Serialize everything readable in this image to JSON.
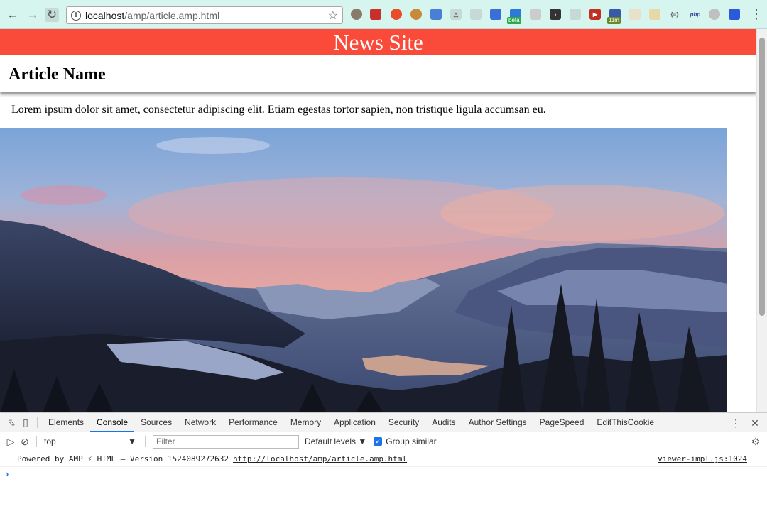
{
  "browser": {
    "url_host": "localhost",
    "url_path": "/amp/article.amp.html",
    "extension_badges": [
      "beta",
      "11m"
    ],
    "ext_labels": [
      "php"
    ]
  },
  "page": {
    "site_title": "News Site",
    "article_title": "Article Name",
    "body_text": "Lorem ipsum dolor sit amet, consectetur adipiscing elit. Etiam egestas tortor sapien, non tristique ligula accumsan eu."
  },
  "devtools": {
    "tabs": [
      "Elements",
      "Console",
      "Sources",
      "Network",
      "Performance",
      "Memory",
      "Application",
      "Security",
      "Audits",
      "Author Settings",
      "PageSpeed",
      "EditThisCookie"
    ],
    "active_tab": "Console",
    "context": "top",
    "filter_placeholder": "Filter",
    "levels": "Default levels",
    "group_similar": "Group similar",
    "console_message": "Powered by AMP ⚡ HTML – Version 1524089272632",
    "console_link": "http://localhost/amp/article.amp.html",
    "console_source": "viewer-impl.js:1024"
  },
  "colors": {
    "site_header": "#fa4b3a",
    "toolbar": "#d6f5ef",
    "accent": "#1a73e8"
  }
}
